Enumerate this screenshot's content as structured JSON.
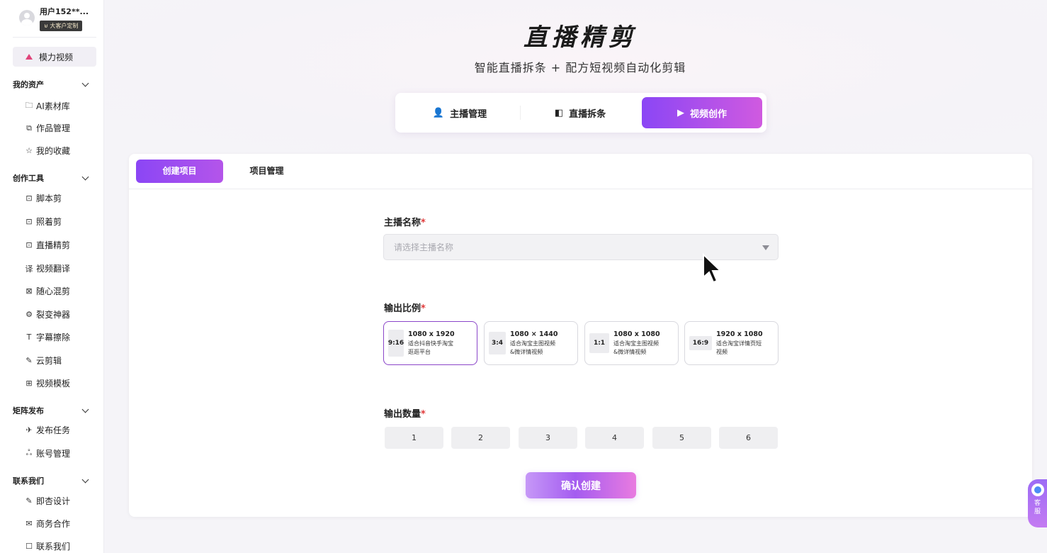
{
  "user": {
    "name": "用户152**...",
    "badge": "大客户定制"
  },
  "sidebar": {
    "brand": "模力视频",
    "groups": [
      {
        "title": "我的资产",
        "items": [
          {
            "icon": "🗀",
            "label": "AI素材库"
          },
          {
            "icon": "⧉",
            "label": "作品管理"
          },
          {
            "icon": "☆",
            "label": "我的收藏"
          }
        ]
      },
      {
        "title": "创作工具",
        "items": [
          {
            "icon": "⊡",
            "label": "脚本剪"
          },
          {
            "icon": "⊡",
            "label": "照着剪"
          },
          {
            "icon": "⊡",
            "label": "直播精剪"
          },
          {
            "icon": "译",
            "label": "视频翻译"
          },
          {
            "icon": "⊠",
            "label": "随心混剪"
          },
          {
            "icon": "⚙",
            "label": "裂变神器"
          },
          {
            "icon": "T",
            "label": "字幕擦除"
          },
          {
            "icon": "✎",
            "label": "云剪辑"
          },
          {
            "icon": "⊞",
            "label": "视频模板"
          }
        ]
      },
      {
        "title": "矩阵发布",
        "items": [
          {
            "icon": "✈",
            "label": "发布任务"
          },
          {
            "icon": "ஃ",
            "label": "账号管理"
          }
        ]
      },
      {
        "title": "联系我们",
        "items": [
          {
            "icon": "✎",
            "label": "即杏设计"
          },
          {
            "icon": "✉",
            "label": "商务合作"
          },
          {
            "icon": "☐",
            "label": "联系我们"
          }
        ]
      }
    ]
  },
  "header": {
    "title": "直播精剪",
    "subtitle": "智能直播拆条 + 配方短视频自动化剪辑",
    "mode_tabs": [
      {
        "icon": "👤",
        "label": "主播管理"
      },
      {
        "icon": "◧",
        "label": "直播拆条"
      },
      {
        "icon": "▶",
        "label": "视频创作"
      }
    ]
  },
  "sub_tabs": [
    "创建项目",
    "项目管理"
  ],
  "form": {
    "anchor_label": "主播名称",
    "anchor_placeholder": "请选择主播名称",
    "ratio_label": "输出比例",
    "ratios": [
      {
        "ratio": "9:16",
        "res": "1080 x 1920",
        "desc1": "适合抖音快手淘宝",
        "desc2": "逛逛平台"
      },
      {
        "ratio": "3:4",
        "res": "1080 × 1440",
        "desc1": "适合淘宝主图视频",
        "desc2": "&微详情视频"
      },
      {
        "ratio": "1:1",
        "res": "1080 x 1080",
        "desc1": "适合淘宝主图视频",
        "desc2": "&微详情视频"
      },
      {
        "ratio": "16:9",
        "res": "1920 x 1080",
        "desc1": "适合淘宝详情页短",
        "desc2": "视频"
      }
    ],
    "count_label": "输出数量",
    "counts": [
      "1",
      "2",
      "3",
      "4",
      "5",
      "6"
    ],
    "required_mark": "*",
    "confirm": "确认创建"
  },
  "service": {
    "label1": "客",
    "label2": "服"
  }
}
